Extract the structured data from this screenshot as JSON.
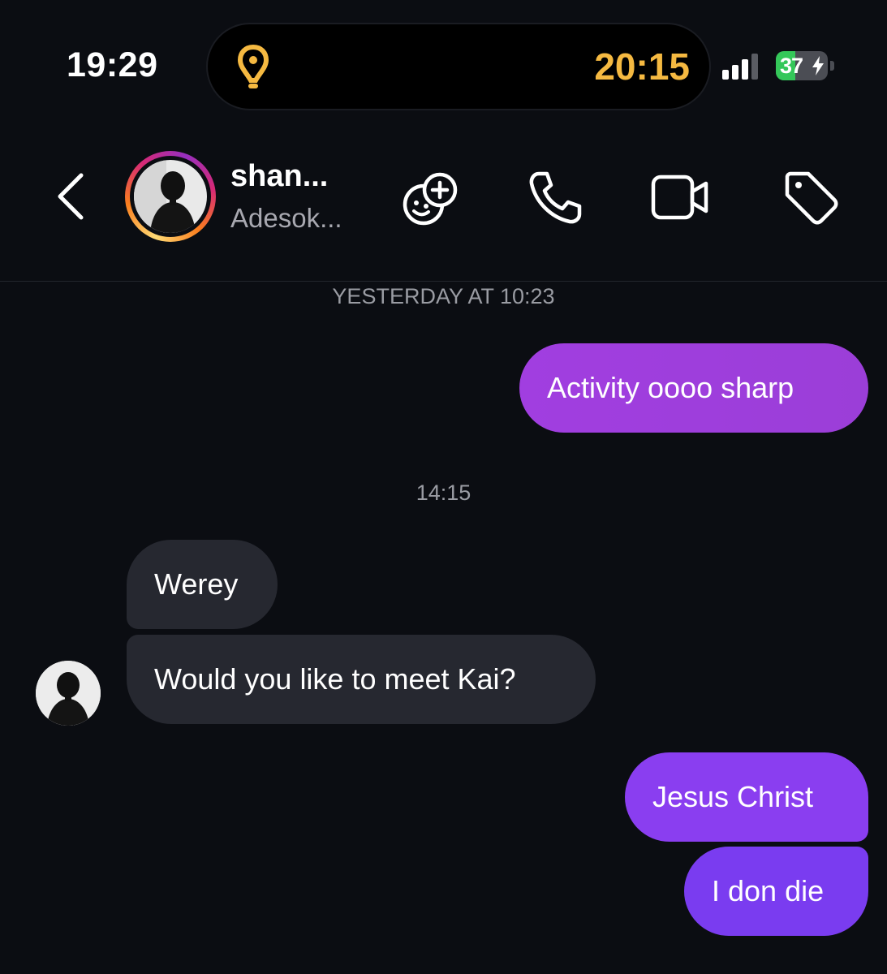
{
  "status_bar": {
    "time": "19:29",
    "island_time": "20:15",
    "battery_percent": "37",
    "battery_level": 0.37,
    "charging": true,
    "colors": {
      "island_time": "#f5b941",
      "battery": "#34c759"
    }
  },
  "header": {
    "name": "shan...",
    "subtitle": "Adesok...",
    "icons": [
      "chevron-left-icon",
      "add-effect-icon",
      "phone-icon",
      "video-camera-icon",
      "tag-icon"
    ],
    "ring_colors": [
      "#feda75",
      "#fa7e1e",
      "#d62976",
      "#962fbf"
    ]
  },
  "messages": {
    "timestamp_1": "YESTERDAY AT 10:23",
    "msg_1": "Activity oooo sharp",
    "timestamp_2": "14:15",
    "msg_2": "Werey",
    "msg_3": "Would you like to meet Kai?",
    "msg_4": "Jesus Christ",
    "msg_5": "I don die",
    "colors": {
      "outgoing_top": "#9b3ede",
      "outgoing_bottom": "#7a3cf0",
      "incoming": "#262830"
    }
  }
}
